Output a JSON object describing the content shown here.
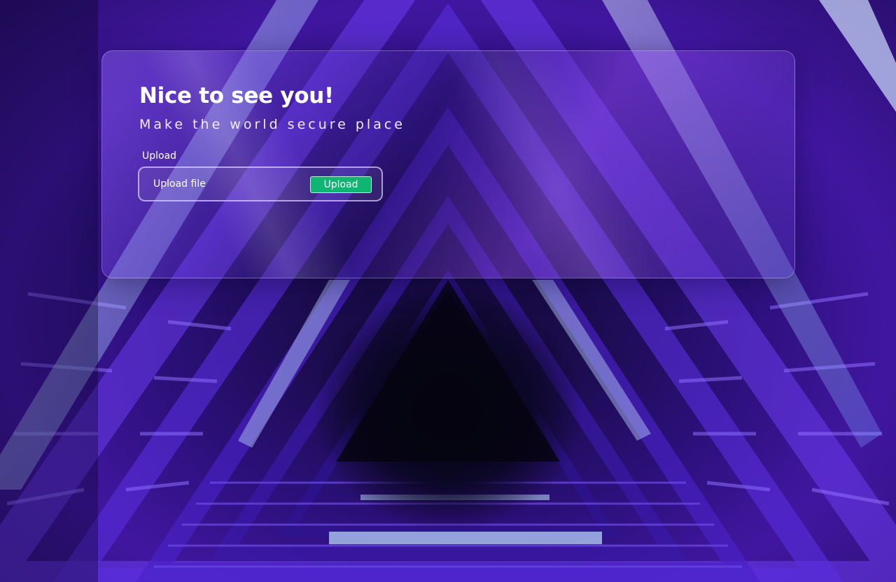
{
  "card": {
    "title": "Nice to see you!",
    "subtitle": "Make the world secure place"
  },
  "upload": {
    "label": "Upload",
    "placeholder": "Upload file",
    "button_label": "Upload"
  },
  "colors": {
    "accent_button": "#10b473",
    "background_purple": "#4b1ab8",
    "text": "#ffffff"
  }
}
